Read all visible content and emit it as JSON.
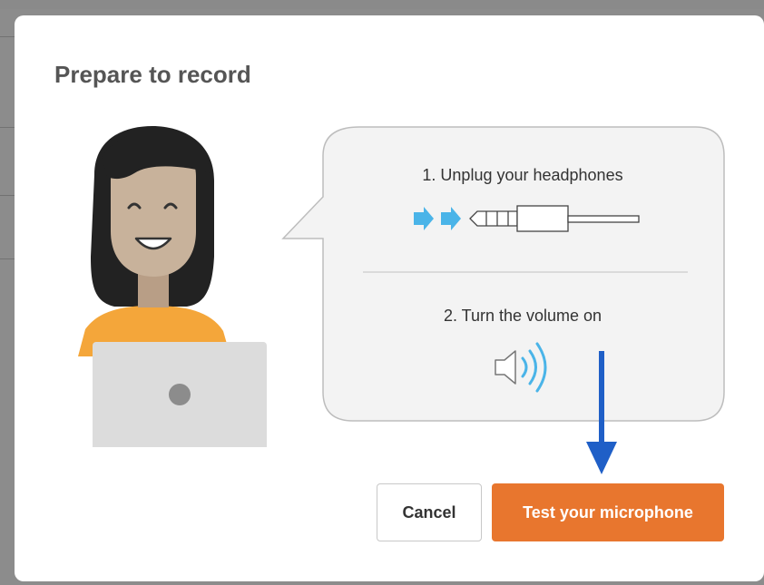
{
  "dialog": {
    "title": "Prepare to record",
    "steps": [
      {
        "label": "1. Unplug your headphones",
        "icon": "headphone-jack-icon"
      },
      {
        "label": "2. Turn the volume on",
        "icon": "speaker-volume-icon"
      }
    ],
    "cancel_label": "Cancel",
    "test_label": "Test your microphone"
  },
  "colors": {
    "primary_button": "#e8762e",
    "arrow_annotation": "#1f5fc7",
    "jack_arrows": "#4ab4e8",
    "speaker_waves": "#4ab4e8"
  }
}
